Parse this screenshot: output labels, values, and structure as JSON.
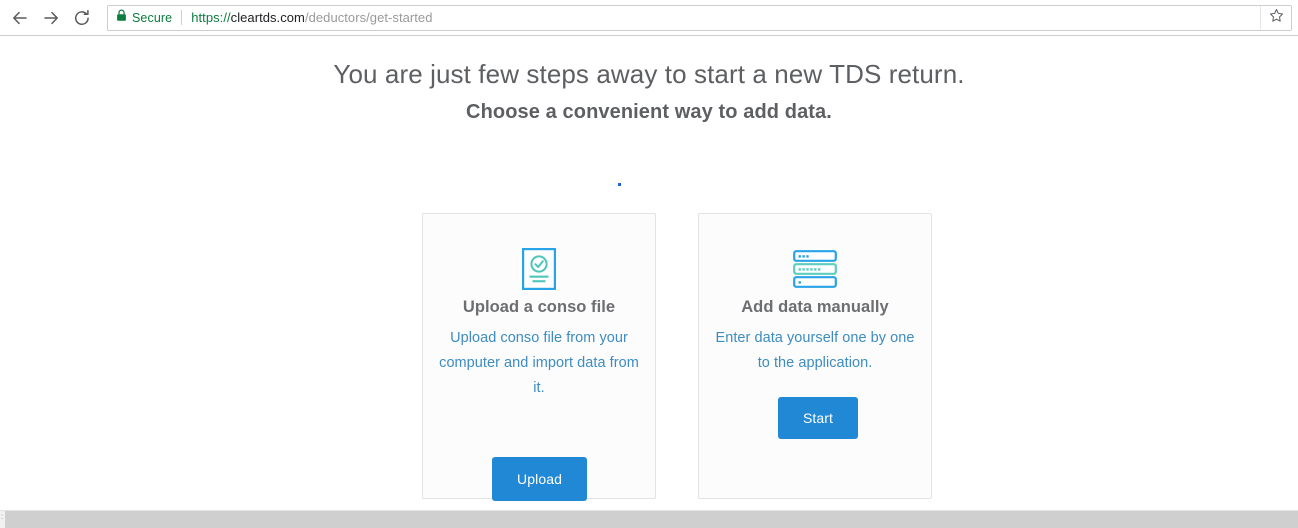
{
  "browser": {
    "nav": {
      "back_label": "Back",
      "back_icon": "arrow-left-icon",
      "forward_label": "Forward",
      "forward_icon": "arrow-right-icon",
      "reload_label": "Reload",
      "reload_icon": "reload-icon"
    },
    "omnibox": {
      "security_icon": "lock-icon",
      "security_label": "Secure",
      "security_color": "#0b7d3e",
      "url_scheme": "https://",
      "url_host": "cleartds.com",
      "url_path": "/deductors/get-started",
      "full_url": "https://cleartds.com/deductors/get-started",
      "bookmark_icon": "star-icon",
      "bookmark_label": "Bookmark this page"
    }
  },
  "page": {
    "headline": "You are just few steps away to start a new TDS return.",
    "subhead": "Choose a convenient way to add data.",
    "accent_color": "#2088d4",
    "heading_color": "#5d5f63",
    "description_color": "#3d8cc2",
    "cards": [
      {
        "id": "upload-conso-file",
        "icon": "document-check-icon",
        "title": "Upload a conso file",
        "description": "Upload conso file from your computer and import data from it.",
        "button_label": "Upload"
      },
      {
        "id": "add-data-manually",
        "icon": "form-rows-icon",
        "title": "Add data manually",
        "description": "Enter data yourself one by one to the application.",
        "button_label": "Start"
      }
    ]
  }
}
